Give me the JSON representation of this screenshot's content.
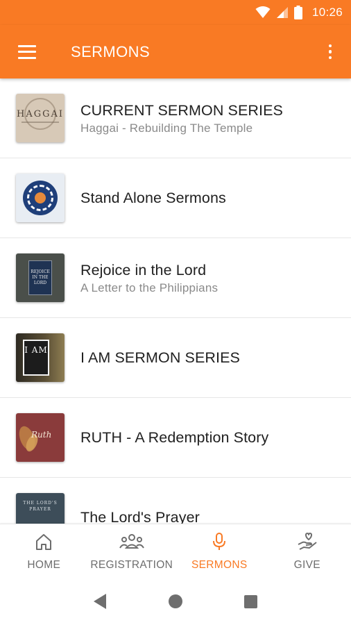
{
  "status_bar": {
    "time": "10:26",
    "icons": [
      "wifi-icon",
      "signal-icon",
      "battery-icon"
    ]
  },
  "app_bar": {
    "title": "SERMONS",
    "menu_icon": "hamburger-menu-icon",
    "overflow_icon": "more-vert-icon"
  },
  "colors": {
    "accent": "#f97a24",
    "title_text": "#212121",
    "subtitle_text": "#8a8a8a",
    "nav_inactive": "#6d6d6d"
  },
  "sermons": [
    {
      "title": "CURRENT SERMON SERIES",
      "subtitle": "Haggai - Rebuilding The Temple",
      "thumb_text": "HAGGAI"
    },
    {
      "title": "Stand Alone Sermons",
      "subtitle": ""
    },
    {
      "title": "Rejoice in the Lord",
      "subtitle": "A Letter to the Philippians",
      "thumb_text": "REJOICE IN THE LORD"
    },
    {
      "title": "I AM SERMON SERIES",
      "subtitle": "",
      "thumb_text": "I AM"
    },
    {
      "title": "RUTH - A Redemption Story",
      "subtitle": "",
      "thumb_text": "Ruth"
    },
    {
      "title": "The Lord's Prayer",
      "subtitle": "",
      "thumb_text": "THE LORD'S PRAYER"
    }
  ],
  "bottom_nav": [
    {
      "label": "HOME",
      "icon": "home-icon",
      "active": false
    },
    {
      "label": "REGISTRATION",
      "icon": "people-group-icon",
      "active": false
    },
    {
      "label": "SERMONS",
      "icon": "microphone-icon",
      "active": true
    },
    {
      "label": "GIVE",
      "icon": "heart-hand-icon",
      "active": false
    }
  ],
  "system_nav": [
    "back-icon",
    "home-circle-icon",
    "recents-icon"
  ]
}
